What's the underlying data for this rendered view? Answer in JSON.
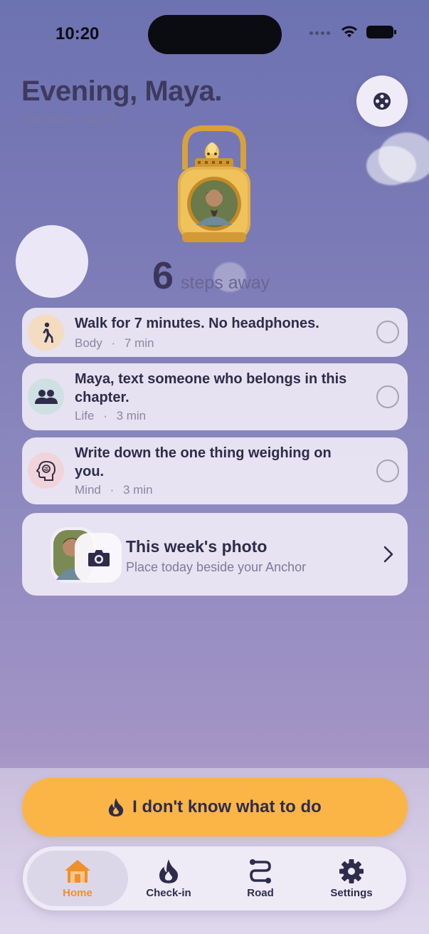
{
  "status_bar": {
    "time": "10:20"
  },
  "header": {
    "greeting": "Evening, Maya.",
    "date": "Saturday, Sep 5"
  },
  "anchor": {
    "steps_count": "6",
    "steps_label": "steps away"
  },
  "tasks": [
    {
      "title": "Walk for 7 minutes. No headphones.",
      "category": "Body",
      "duration": "7 min",
      "icon": "walking-person-icon",
      "color": "#f4dcc0"
    },
    {
      "title": "Maya, text someone who belongs in this chapter.",
      "category": "Life",
      "duration": "3 min",
      "icon": "people-icon",
      "color": "#cfe0e2"
    },
    {
      "title": "Write down the one thing weighing on you.",
      "category": "Mind",
      "duration": "3 min",
      "icon": "brain-head-icon",
      "color": "#f0d4da"
    }
  ],
  "meta_separator": "·",
  "photo_card": {
    "title": "This week's photo",
    "subtitle": "Place today beside your Anchor"
  },
  "cta": {
    "label": "I don't know what to do"
  },
  "tabs": [
    {
      "label": "Home",
      "icon": "home-icon"
    },
    {
      "label": "Check-in",
      "icon": "flame-icon"
    },
    {
      "label": "Road",
      "icon": "road-icon"
    },
    {
      "label": "Settings",
      "icon": "gear-icon"
    }
  ],
  "colors": {
    "accent": "#f0902b",
    "cta": "#fbb446",
    "text": "#2e2c4a"
  }
}
